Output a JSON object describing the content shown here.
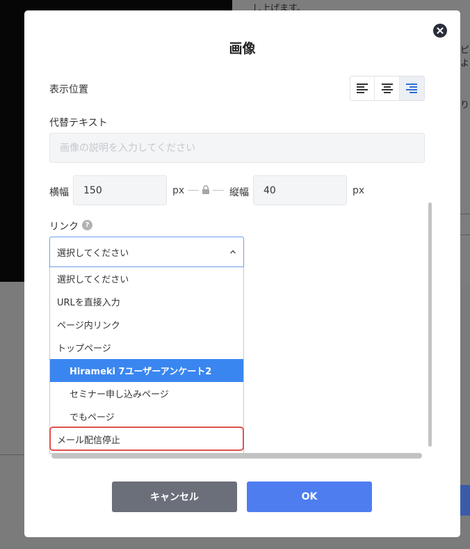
{
  "background": {
    "text_top": "し上げます。",
    "text_right1": "ピ",
    "text_right2": "よ",
    "text_right3": "り",
    "text_right4": "て"
  },
  "modal": {
    "title": "画像",
    "position_label": "表示位置",
    "align_options": [
      "align-left-icon",
      "align-center-icon",
      "align-right-icon"
    ],
    "align_selected": "right",
    "alt_label": "代替テキスト",
    "alt_value": "",
    "alt_placeholder": "画像の説明を入力してください",
    "width_label": "横幅",
    "width_value": "150",
    "height_label": "縦幅",
    "height_value": "40",
    "unit": "px",
    "link_label": "リンク",
    "help_mark": "?",
    "link_select_value": "選択してください",
    "link_options": [
      {
        "label": "選択してください"
      },
      {
        "label": "URLを直接入力"
      },
      {
        "label": "ページ内リンク"
      },
      {
        "label": "トップページ"
      },
      {
        "label": "Hirameki 7ユーザーアンケート2"
      },
      {
        "label": "セミナー申し込みページ"
      },
      {
        "label": "でもページ"
      },
      {
        "label": "メール配信停止"
      }
    ],
    "link_selected_index": 4,
    "cancel_label": "キャンセル",
    "ok_label": "OK"
  },
  "colors": {
    "primary": "#4e7df0",
    "selected_option": "#3a86f0",
    "highlight": "#e0524d",
    "cancel": "#6b6f7a"
  }
}
